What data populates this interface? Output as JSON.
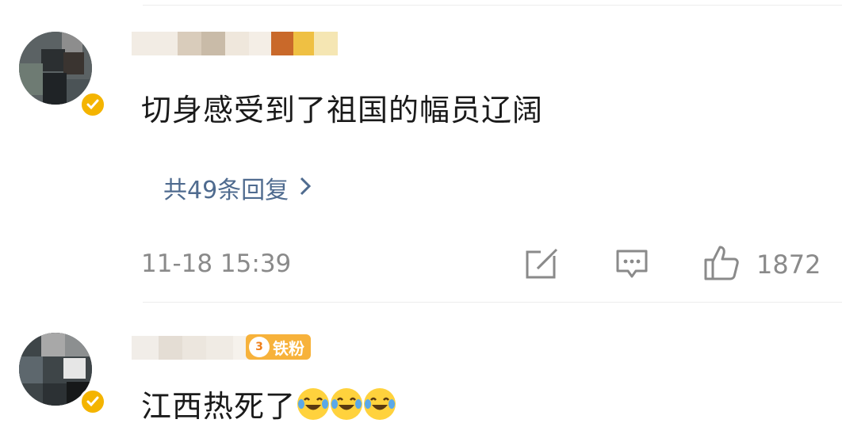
{
  "comments": [
    {
      "text": "切身感受到了祖国的幅员辽阔",
      "replies_label": "共49条回复",
      "timestamp": "11-18 15:39",
      "likes": "1872",
      "verified": true
    },
    {
      "text": "江西热死了",
      "fan_badge": {
        "level": "3",
        "label": "铁粉"
      },
      "verified": true,
      "emoji": [
        "laugh-cry",
        "laugh-cry",
        "laugh-cry"
      ]
    }
  ],
  "colors": {
    "reply_link": "#4f6b8f",
    "meta_text": "#8a8a8a",
    "body_text": "#1a1a1a",
    "badge": "#f7b23b",
    "verified": "#f4b400"
  },
  "icons": [
    "share-icon",
    "comment-icon",
    "like-icon",
    "chevron-right-icon"
  ]
}
